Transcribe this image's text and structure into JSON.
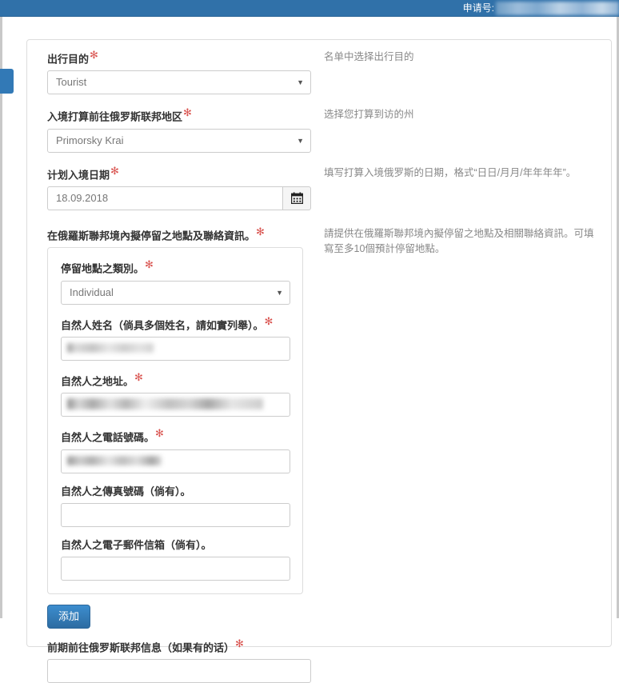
{
  "header": {
    "application_number_label": "申请号:",
    "value_redacted": true
  },
  "colors": {
    "header_bg": "#3071a9",
    "accent": "#3279b6",
    "required_star": "#d9534f",
    "hint_text": "#888888",
    "border": "#dddddd"
  },
  "sidebar": {
    "toggle_tab_name": "sidebar-toggle-tab"
  },
  "form": {
    "fields": [
      {
        "label": "出行目的",
        "required": true,
        "control": "select",
        "value": "Tourist",
        "hint": "名单中选择出行目的"
      },
      {
        "label": "入境打算前往俄罗斯联邦地区",
        "required": true,
        "control": "select",
        "value": "Primorsky Krai",
        "hint": "选择您打算到访的州"
      },
      {
        "label": "计划入境日期",
        "required": true,
        "control": "date",
        "value": "18.09.2018",
        "hint": "填写打算入境俄罗斯的日期，格式“日日/月月/年年年年”。",
        "button_icon": "calendar-icon"
      },
      {
        "label": "在俄羅斯聯邦境內擬停留之地點及聯絡資訊。",
        "required": true,
        "control": "fieldset",
        "hint": "請提供在俄羅斯聯邦境內擬停留之地點及相關聯絡資訊。可填寫至多10個預計停留地點。"
      }
    ],
    "stay_card": {
      "fields": [
        {
          "label": "停留地點之類別。",
          "required": true,
          "control": "select",
          "value": "Individual"
        },
        {
          "label": "自然人姓名（倘具多個姓名，請如實列舉）。",
          "required": true,
          "control": "text",
          "value": "",
          "redacted": true
        },
        {
          "label": "自然人之地址。",
          "required": true,
          "control": "text",
          "value": "",
          "redacted": true
        },
        {
          "label": "自然人之電話號碼。",
          "required": true,
          "control": "text",
          "value": "",
          "redacted": true
        },
        {
          "label": "自然人之傳真號碼（倘有）。",
          "required": false,
          "control": "text",
          "value": ""
        },
        {
          "label": "自然人之電子郵件信箱（倘有）。",
          "required": false,
          "control": "text",
          "value": ""
        }
      ]
    },
    "add_button_label": "添加",
    "bottom_field": {
      "label": "前期前往俄罗斯联邦信息（如果有的话）",
      "required": true,
      "control": "text",
      "value": ""
    }
  }
}
